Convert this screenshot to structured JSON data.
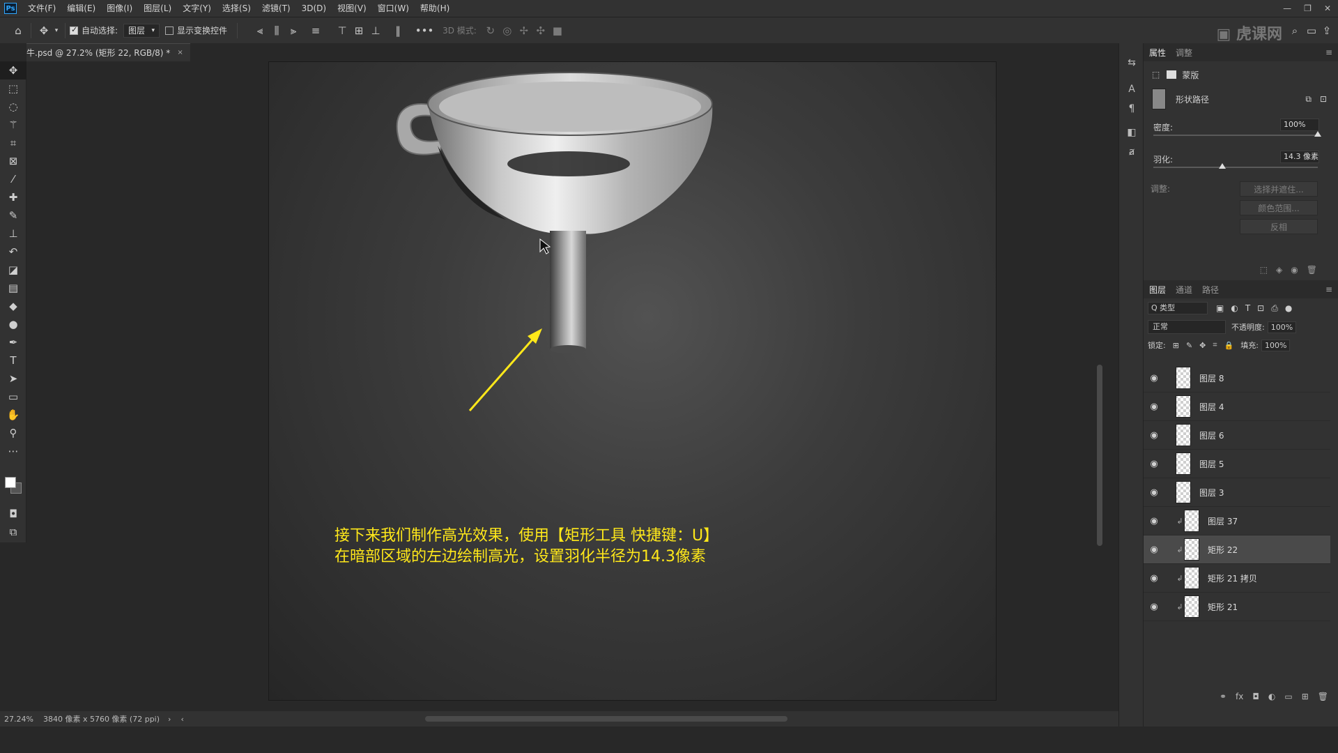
{
  "app": {
    "logo": "Ps"
  },
  "menu": [
    "文件(F)",
    "编辑(E)",
    "图像(I)",
    "图层(L)",
    "文字(Y)",
    "选择(S)",
    "滤镜(T)",
    "3D(D)",
    "视图(V)",
    "窗口(W)",
    "帮助(H)"
  ],
  "window_controls": [
    "—",
    "❐",
    "✕"
  ],
  "options": {
    "auto_select_label": "自动选择:",
    "auto_select_value": "图层",
    "show_transform_label": "显示变换控件",
    "mode_3d_label": "3D 模式:",
    "more": "•••"
  },
  "document_tab": {
    "title": "牛.psd @ 27.2% (矩形 22, RGB/8) *",
    "close": "×"
  },
  "annotation": {
    "line1": "接下来我们制作高光效果，使用【矩形工具 快捷键：U】",
    "line2": "在暗部区域的左边绘制高光，设置羽化半径为14.3像素"
  },
  "status": {
    "zoom": "27.24%",
    "doc_info": "3840 像素 x 5760 像素 (72 ppi)"
  },
  "properties": {
    "tabs": [
      "属性",
      "调整"
    ],
    "mask_label": "蒙版",
    "shape_path_label": "形状路径",
    "density_label": "密度:",
    "density_value": "100%",
    "density_level": 1.0,
    "feather_label": "羽化:",
    "feather_value": "14.3 像素",
    "feather_level": 0.42,
    "adjust_label": "调整:",
    "btn_select_mask": "选择并遮住...",
    "btn_color_range": "颜色范围...",
    "btn_invert": "反相"
  },
  "layers_panel": {
    "tabs": [
      "图层",
      "通道",
      "路径"
    ],
    "filter_label": "Q 类型",
    "blend_mode": "正常",
    "opacity_label": "不透明度:",
    "opacity_value": "100%",
    "lock_label": "锁定:",
    "fill_label": "填充:",
    "fill_value": "100%",
    "layers": [
      {
        "name": "图层 8",
        "clipped": false,
        "selected": false
      },
      {
        "name": "图层 4",
        "clipped": false,
        "selected": false
      },
      {
        "name": "图层 6",
        "clipped": false,
        "selected": false
      },
      {
        "name": "图层 5",
        "clipped": false,
        "selected": false
      },
      {
        "name": "图层 3",
        "clipped": false,
        "selected": false
      },
      {
        "name": "图层 37",
        "clipped": true,
        "selected": false
      },
      {
        "name": "矩形 22",
        "clipped": true,
        "selected": true
      },
      {
        "name": "矩形 21 拷贝",
        "clipped": true,
        "selected": false
      },
      {
        "name": "矩形 21",
        "clipped": true,
        "selected": false
      }
    ]
  },
  "colors": {
    "annotation": "#ffe81a",
    "ui_bg": "#323232",
    "accent": "#31a8ff"
  }
}
